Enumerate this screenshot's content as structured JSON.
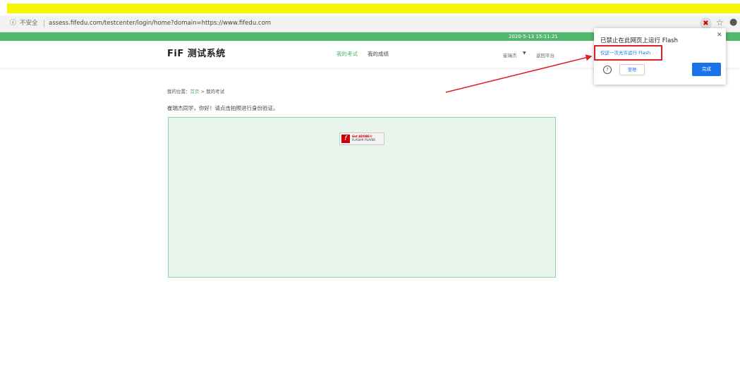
{
  "browser": {
    "insecure_label": "不安全",
    "url": "assess.fifedu.com/testcenter/login/home?domain=https://www.fifedu.com"
  },
  "topbar": {
    "datetime": "2020-5-13 15:11:21"
  },
  "header": {
    "logo": "FiF 测试系统",
    "nav": [
      "我的考试",
      "我的成绩"
    ],
    "user": "崔瑞杰",
    "back": "返回平台"
  },
  "breadcrumb": {
    "prefix": "我的位置：",
    "home": "首页",
    "separator": " > ",
    "current": "我的考试"
  },
  "greeting": "崔瑞杰同学，你好！请点击拍照进行身份验证。",
  "flash_badge": {
    "line1": "Get ADOBE®",
    "line2": "FLASH® PLAYER"
  },
  "popup": {
    "title": "已禁止在此网页上运行 Flash",
    "allow_link": "仅这一次允许运行 Flash",
    "manage": "管理",
    "done": "完成"
  },
  "colors": {
    "accent": "#52b86e",
    "highlight": "#f7f700",
    "annotation": "#e02020",
    "link": "#1a73e8"
  },
  "icons": [
    "info-icon",
    "flash-blocked-icon",
    "star-icon",
    "account-icon",
    "dropdown-icon",
    "flash-logo-icon",
    "close-icon",
    "help-icon"
  ]
}
